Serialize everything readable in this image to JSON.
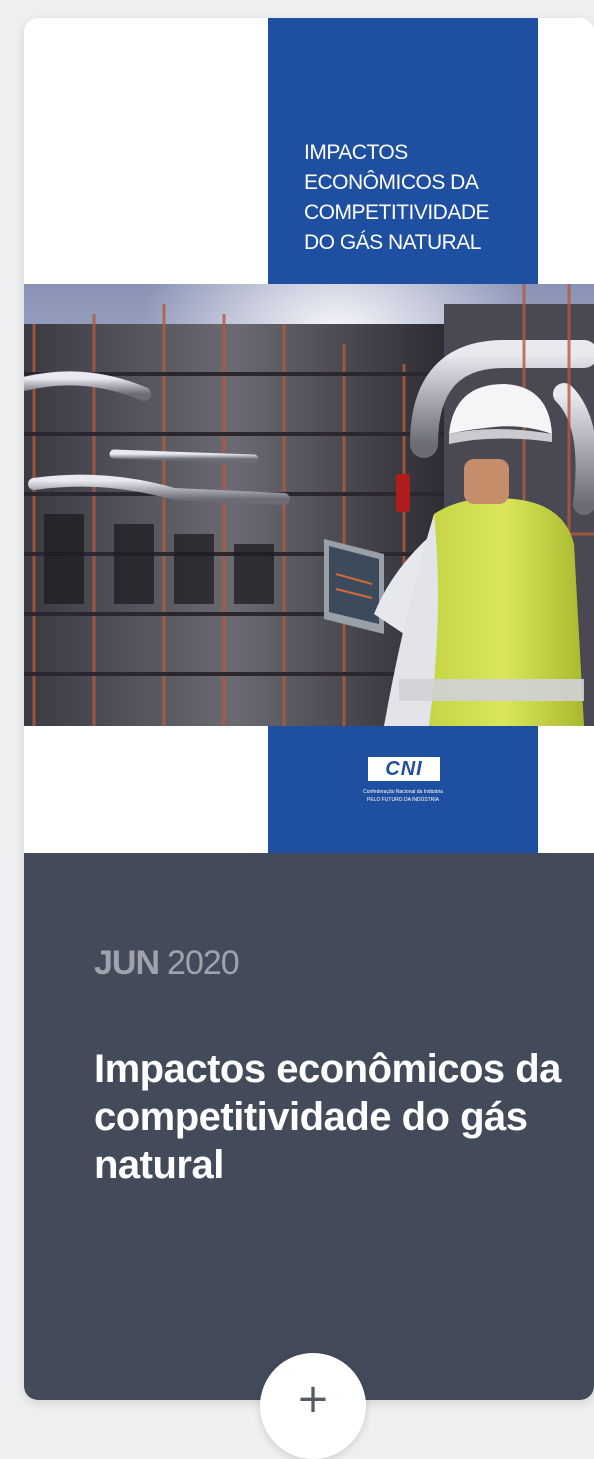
{
  "publication": {
    "cover": {
      "title": "IMPACTOS\nECONÔMICOS DA\nCOMPETITIVIDADE\nDO GÁS NATURAL",
      "logo_text": "CNI",
      "logo_caption": "Confederação Nacional da Indústria\nPELO FUTURO DA INDÚSTRIA",
      "photo_alt": "Engineer with laptop in front of an industrial gas plant",
      "brand_color": "#1f4fa0"
    },
    "date_month": "JUN",
    "date_year": "2020",
    "title": "Impactos econômicos da competitividade do gás natural",
    "panel_color": "#434b5a"
  },
  "expand_button": {
    "icon": "plus-icon",
    "symbol": "+"
  }
}
